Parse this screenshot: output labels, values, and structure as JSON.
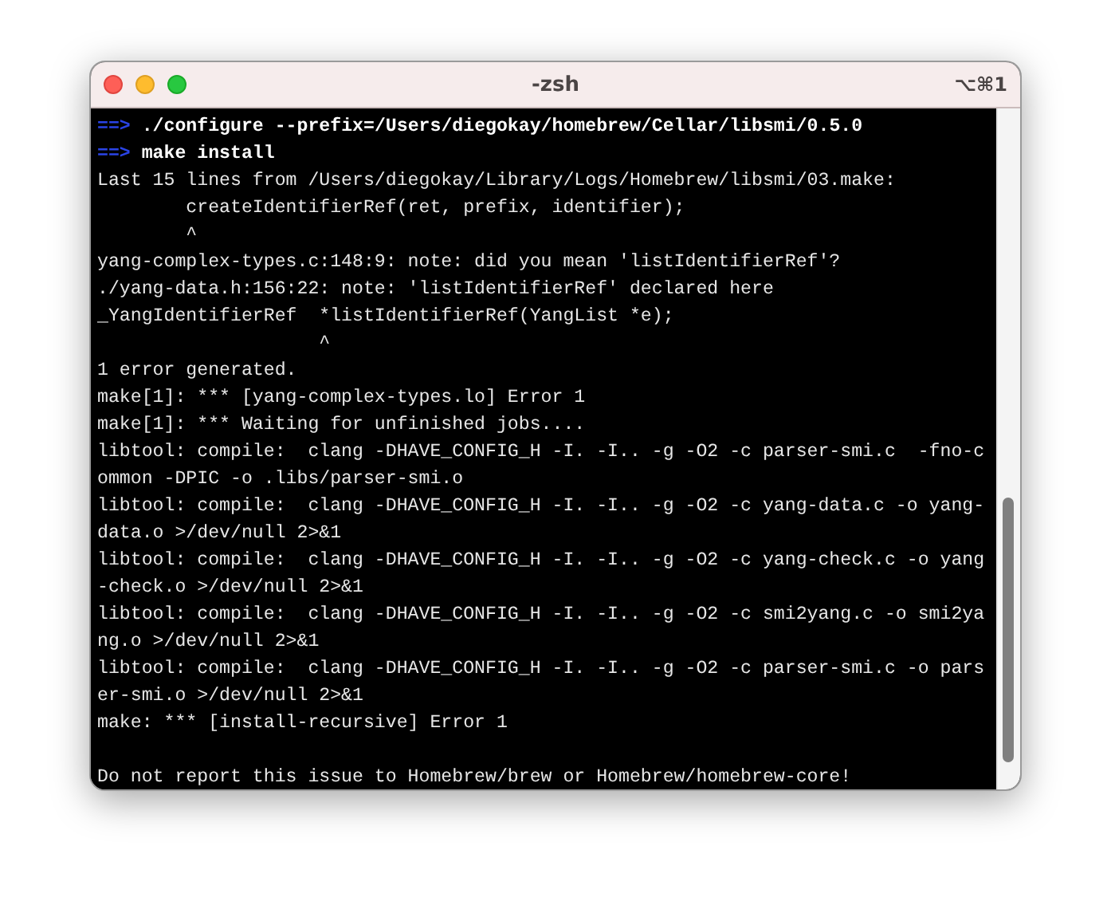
{
  "window": {
    "title": "-zsh",
    "shortcut": "⌥⌘1"
  },
  "terminal": {
    "lines": [
      {
        "kind": "command",
        "prompt": "==>",
        "text": "./configure --prefix=/Users/diegokay/homebrew/Cellar/libsmi/0.5.0"
      },
      {
        "kind": "command",
        "prompt": "==>",
        "text": "make install"
      },
      {
        "kind": "output",
        "text": "Last 15 lines from /Users/diegokay/Library/Logs/Homebrew/libsmi/03.make:"
      },
      {
        "kind": "output",
        "text": "        createIdentifierRef(ret, prefix, identifier);"
      },
      {
        "kind": "output",
        "text": "        ^"
      },
      {
        "kind": "output",
        "text": "yang-complex-types.c:148:9: note: did you mean 'listIdentifierRef'?"
      },
      {
        "kind": "output",
        "text": "./yang-data.h:156:22: note: 'listIdentifierRef' declared here"
      },
      {
        "kind": "output",
        "text": "_YangIdentifierRef  *listIdentifierRef(YangList *e);"
      },
      {
        "kind": "output",
        "text": "                    ^"
      },
      {
        "kind": "output",
        "text": "1 error generated."
      },
      {
        "kind": "output",
        "text": "make[1]: *** [yang-complex-types.lo] Error 1"
      },
      {
        "kind": "output",
        "text": "make[1]: *** Waiting for unfinished jobs...."
      },
      {
        "kind": "output",
        "text": "libtool: compile:  clang -DHAVE_CONFIG_H -I. -I.. -g -O2 -c parser-smi.c  -fno-c"
      },
      {
        "kind": "output",
        "text": "ommon -DPIC -o .libs/parser-smi.o"
      },
      {
        "kind": "output",
        "text": "libtool: compile:  clang -DHAVE_CONFIG_H -I. -I.. -g -O2 -c yang-data.c -o yang-"
      },
      {
        "kind": "output",
        "text": "data.o >/dev/null 2>&1"
      },
      {
        "kind": "output",
        "text": "libtool: compile:  clang -DHAVE_CONFIG_H -I. -I.. -g -O2 -c yang-check.c -o yang"
      },
      {
        "kind": "output",
        "text": "-check.o >/dev/null 2>&1"
      },
      {
        "kind": "output",
        "text": "libtool: compile:  clang -DHAVE_CONFIG_H -I. -I.. -g -O2 -c smi2yang.c -o smi2ya"
      },
      {
        "kind": "output",
        "text": "ng.o >/dev/null 2>&1"
      },
      {
        "kind": "output",
        "text": "libtool: compile:  clang -DHAVE_CONFIG_H -I. -I.. -g -O2 -c parser-smi.c -o pars"
      },
      {
        "kind": "output",
        "text": "er-smi.o >/dev/null 2>&1"
      },
      {
        "kind": "output",
        "text": "make: *** [install-recursive] Error 1"
      },
      {
        "kind": "blank"
      },
      {
        "kind": "output",
        "text": "Do not report this issue to Homebrew/brew or Homebrew/homebrew-core!"
      }
    ]
  }
}
